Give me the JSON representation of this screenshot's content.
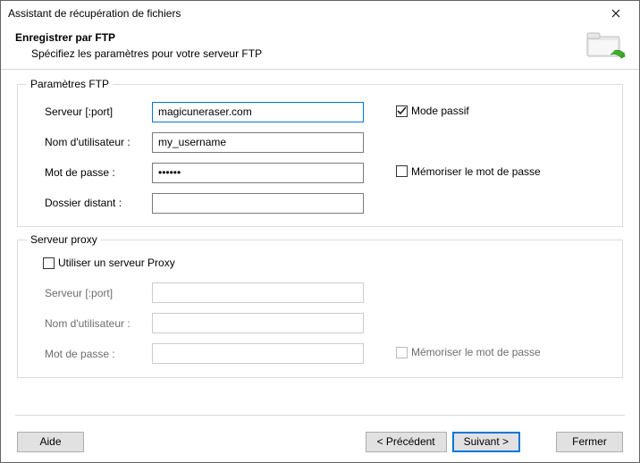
{
  "window": {
    "title": "Assistant de récupération de fichiers"
  },
  "header": {
    "title": "Enregistrer par FTP",
    "subtitle": "Spécifiez les paramètres pour votre serveur FTP"
  },
  "ftp": {
    "legend": "Paramètres FTP",
    "server_label": "Serveur [:port]",
    "server_value": "magicuneraser.com",
    "user_label": "Nom d'utilisateur :",
    "user_value": "my_username",
    "pass_label": "Mot de passe :",
    "pass_value": "••••••",
    "remote_label": "Dossier distant :",
    "remote_value": "",
    "passive_label": "Mode passif",
    "passive_checked": true,
    "remember_label": "Mémoriser le mot de passe",
    "remember_checked": false
  },
  "proxy": {
    "legend": "Serveur proxy",
    "use_proxy_label": "Utiliser un serveur Proxy",
    "use_proxy_checked": false,
    "server_label": "Serveur [:port]",
    "server_value": "",
    "user_label": "Nom d'utilisateur :",
    "user_value": "",
    "pass_label": "Mot de passe :",
    "pass_value": "",
    "remember_label": "Mémoriser le mot de passe",
    "remember_checked": false
  },
  "footer": {
    "help": "Aide",
    "back": "< Précédent",
    "next": "Suivant >",
    "close": "Fermer"
  }
}
